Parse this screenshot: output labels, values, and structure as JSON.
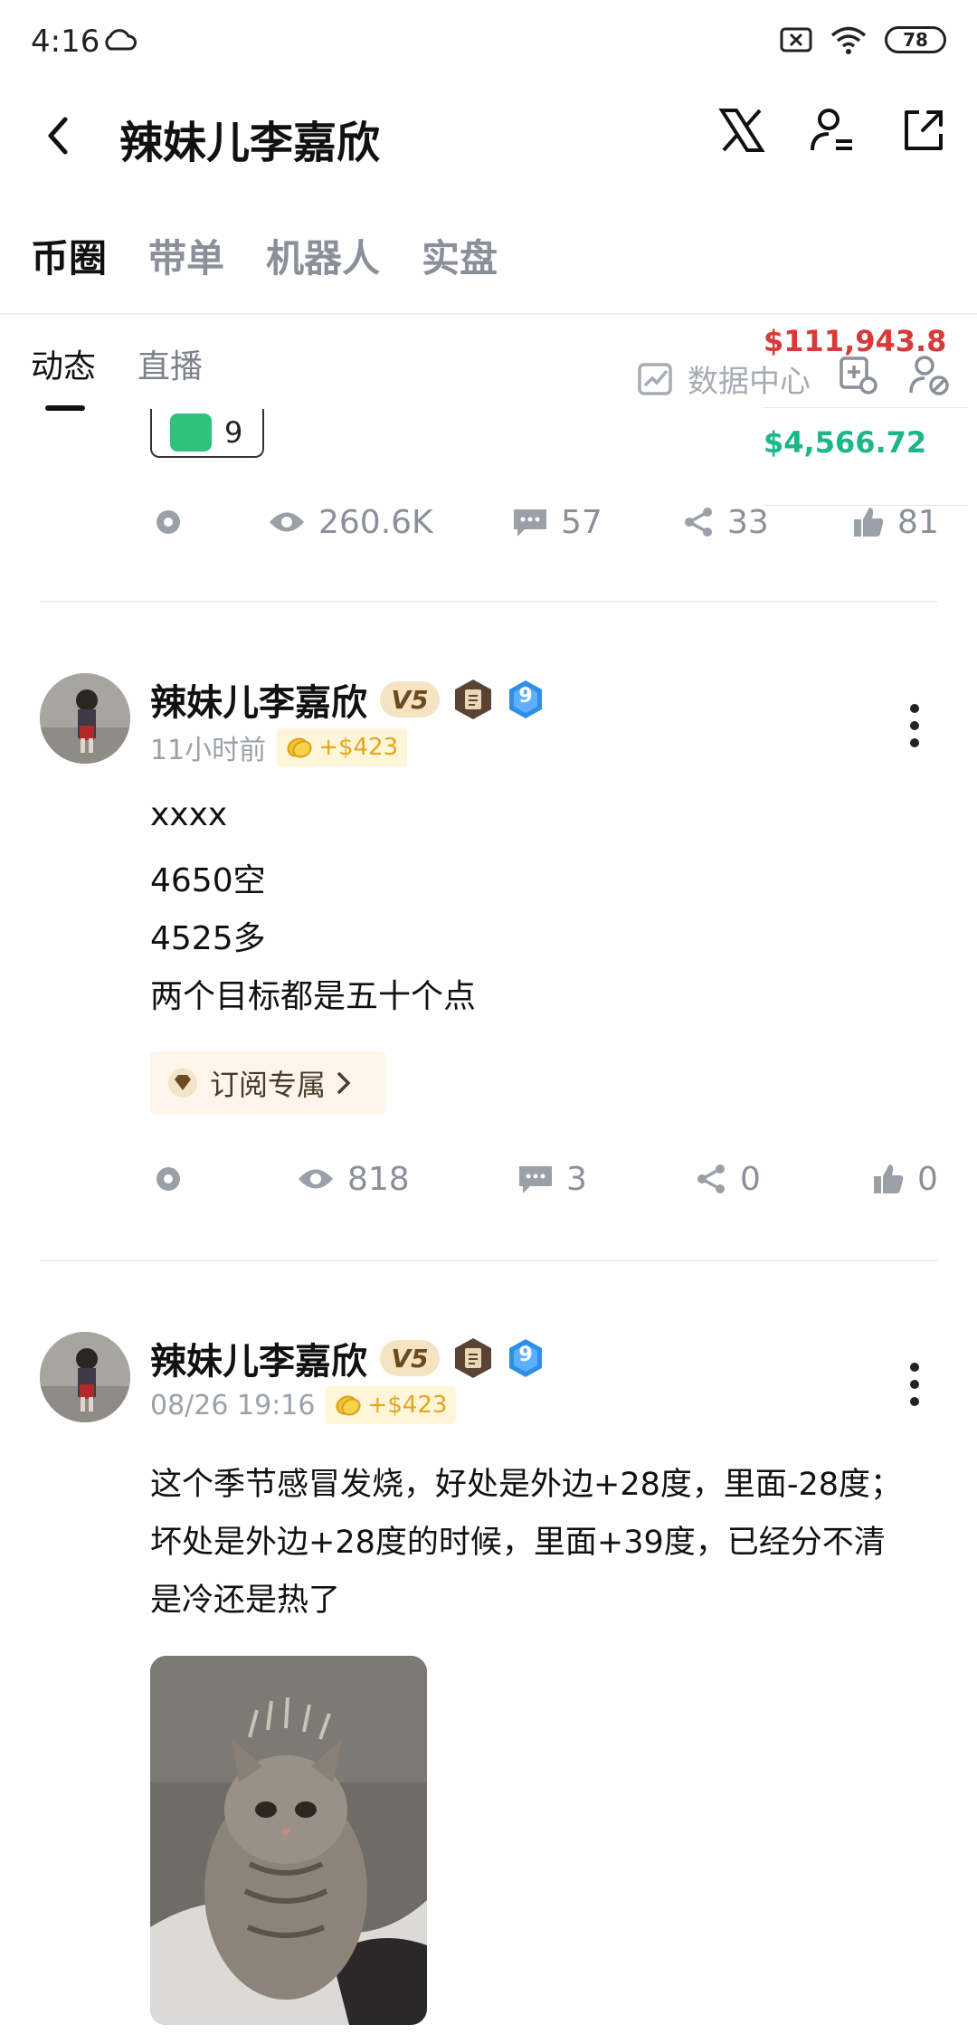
{
  "status_bar": {
    "time": "4:16",
    "battery": "78"
  },
  "header": {
    "title": "辣妹儿李嘉欣"
  },
  "main_tabs": [
    "币圈",
    "带单",
    "机器人",
    "实盘"
  ],
  "sub_tabs": [
    "动态",
    "直播"
  ],
  "data_center": "数据中心",
  "pnl": {
    "total": "$111,943.8",
    "today": "$4,566.72"
  },
  "reaction": {
    "count": "9"
  },
  "posts": [
    {
      "stats": {
        "views": "260.6K",
        "comments": "57",
        "shares": "33",
        "likes": "81"
      }
    },
    {
      "author": "辣妹儿李嘉欣",
      "vip": "V5",
      "level": "9",
      "time": "11小时前",
      "profit": "+$423",
      "lines": [
        "xxxx",
        "4650空",
        "4525多",
        "两个目标都是五十个点"
      ],
      "subscribe_label": "订阅专属",
      "stats": {
        "views": "818",
        "comments": "3",
        "shares": "0",
        "likes": "0"
      }
    },
    {
      "author": "辣妹儿李嘉欣",
      "vip": "V5",
      "level": "9",
      "time": "08/26 19:16",
      "profit": "+$423",
      "lines": [
        "这个季节感冒发烧，好处是外边+28度，里面-28度；",
        "坏处是外边+28度的时候，里面+39度，已经分不清",
        "是冷还是热了"
      ]
    }
  ],
  "colors": {
    "profit_red": "#d83a3a",
    "profit_green": "#1bb68a",
    "coin_gold": "#e3a51f",
    "level_blue": "#2f8fe6"
  }
}
